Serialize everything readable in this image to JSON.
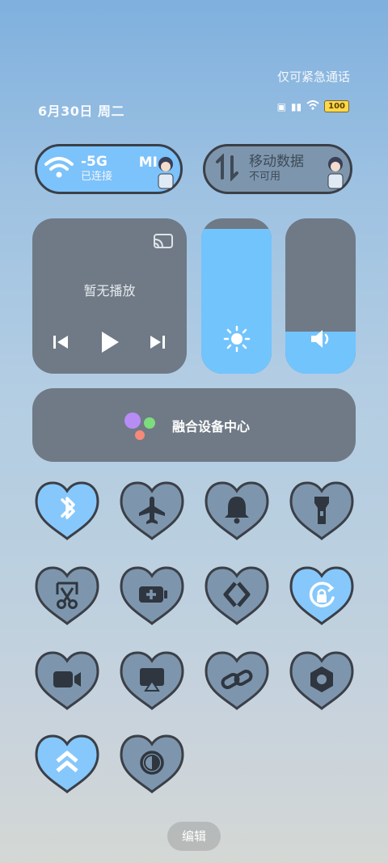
{
  "status": {
    "emergency_text": "仅可紧急通话",
    "date": "6月30日 周二",
    "battery": "100"
  },
  "wifi_tile": {
    "title": "-5G",
    "subtitle": "已连接",
    "extra": "MI"
  },
  "data_tile": {
    "title": "移动数据",
    "subtitle": "不可用"
  },
  "media": {
    "title": "暂无播放"
  },
  "sliders": {
    "brightness_level": 0.93,
    "volume_level": 0.27
  },
  "fusion": {
    "label": "融合设备中心"
  },
  "edit": {
    "label": "编辑"
  },
  "toggles": [
    {
      "icon": "bluetooth-icon",
      "active": true
    },
    {
      "icon": "airplane-icon",
      "active": false
    },
    {
      "icon": "bell-icon",
      "active": false
    },
    {
      "icon": "flashlight-icon",
      "active": false
    },
    {
      "icon": "screenshot-icon",
      "active": false
    },
    {
      "icon": "battery-saver-icon",
      "active": false
    },
    {
      "icon": "share-icon",
      "active": false
    },
    {
      "icon": "rotation-lock-icon",
      "active": true
    },
    {
      "icon": "screen-record-icon",
      "active": false
    },
    {
      "icon": "cast-icon",
      "active": false
    },
    {
      "icon": "link-icon",
      "active": false
    },
    {
      "icon": "settings-nut-icon",
      "active": false
    },
    {
      "icon": "performance-icon",
      "active": true
    },
    {
      "icon": "dark-mode-icon",
      "active": false
    }
  ],
  "colors": {
    "active": "#86c8fb",
    "inactive": "#7d96ad",
    "outline": "#3b3f47"
  }
}
